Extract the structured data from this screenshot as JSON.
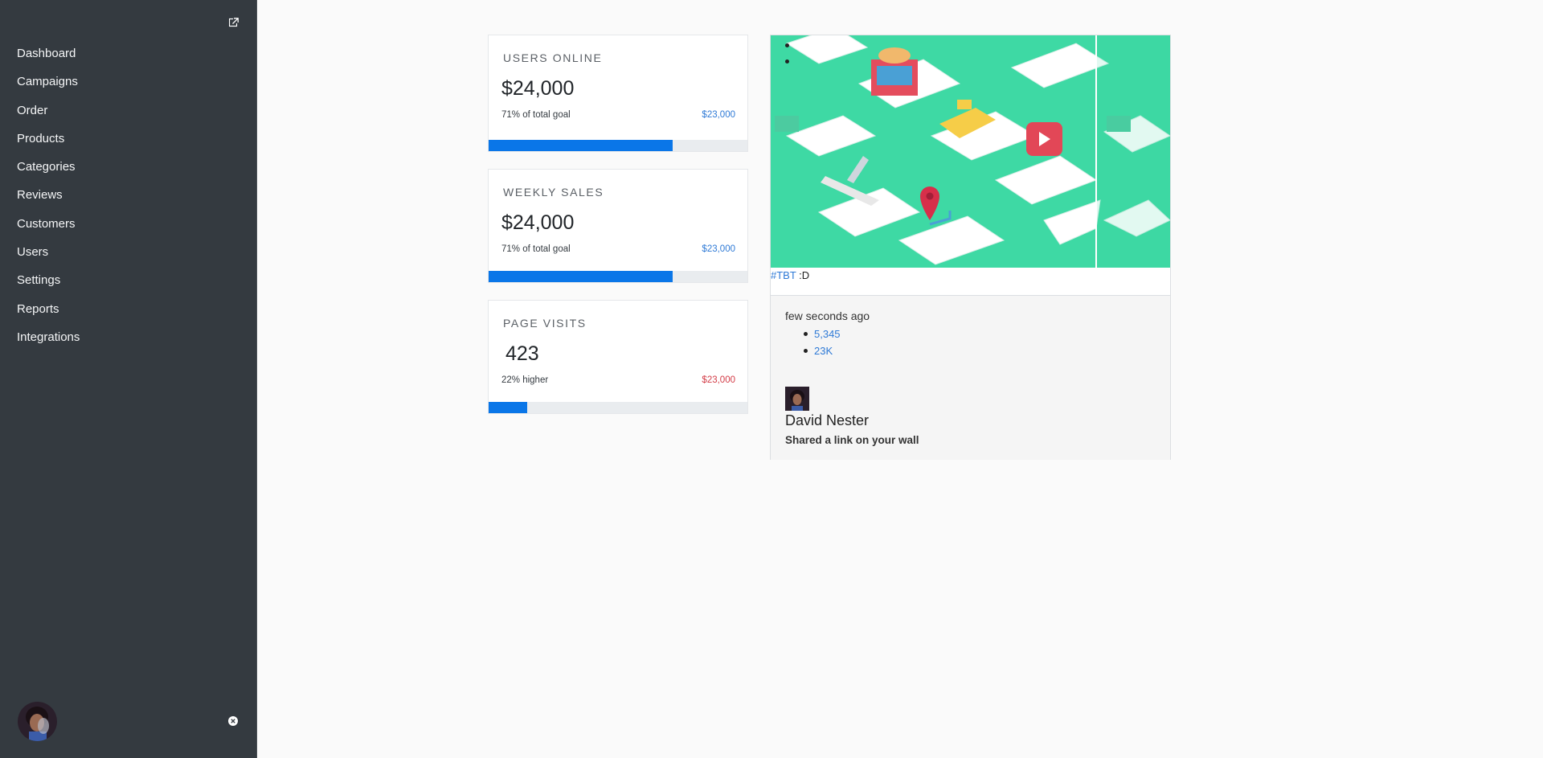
{
  "sidebar": {
    "items": [
      {
        "label": "Dashboard"
      },
      {
        "label": "Campaigns"
      },
      {
        "label": "Order"
      },
      {
        "label": "Products"
      },
      {
        "label": "Categories"
      },
      {
        "label": "Reviews"
      },
      {
        "label": "Customers"
      },
      {
        "label": "Users"
      },
      {
        "label": "Settings"
      },
      {
        "label": "Reports"
      },
      {
        "label": "Integrations"
      }
    ]
  },
  "cards": [
    {
      "label": "USERS ONLINE",
      "value": "$24,000",
      "meta": "71% of total goal",
      "amount": "$23,000",
      "progress": 0.71,
      "amount_color": "#2f7ad6"
    },
    {
      "label": "WEEKLY SALES",
      "value": "$24,000",
      "meta": "71% of total goal",
      "amount": "$23,000",
      "progress": 0.71,
      "amount_color": "#2f7ad6"
    },
    {
      "label": "PAGE VISITS",
      "value": "423",
      "meta": "22% higher",
      "amount": "$23,000",
      "progress": 0.15,
      "amount_color": "#d33b46"
    }
  ],
  "social": {
    "hashtag": "#TBT",
    "caption_text": " :D",
    "time": "few seconds ago",
    "stats": [
      "5,345",
      "23K"
    ],
    "user_name": "David Nester",
    "message": "Shared a link on your wall"
  },
  "colors": {
    "sidebar_bg": "#343a40",
    "accent": "#0a76e8",
    "link": "#2f7ad6",
    "danger": "#d33b46",
    "image_bg": "#3ed9a4"
  },
  "icons": {
    "expand": "external-link-icon",
    "close": "close-circle-icon"
  }
}
